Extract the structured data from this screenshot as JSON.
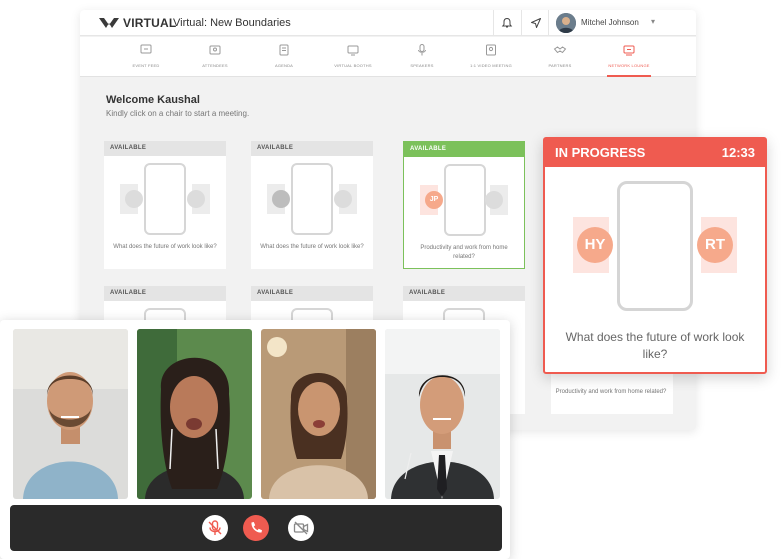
{
  "app": {
    "brand": "VIRTUAL",
    "event_title": "Virtual: New Boundaries",
    "user_name": "Mitchel Johnson"
  },
  "nav": [
    {
      "label": "EVENT FEED",
      "icon": "event-feed-icon"
    },
    {
      "label": "ATTENDEES",
      "icon": "attendees-icon"
    },
    {
      "label": "AGENDA",
      "icon": "agenda-icon"
    },
    {
      "label": "VIRTUAL BOOTHS",
      "icon": "virtual-booths-icon"
    },
    {
      "label": "SPEAKERS",
      "icon": "speakers-icon"
    },
    {
      "label": "1:1 VIDEO MEETING",
      "icon": "video-meeting-icon"
    },
    {
      "label": "PARTNERS",
      "icon": "partners-icon"
    },
    {
      "label": "NETWORK LOUNGE",
      "icon": "network-lounge-icon",
      "active": true
    }
  ],
  "lounge": {
    "welcome": "Welcome Kaushal",
    "subtitle": "Kindly click on a chair to start a meeting."
  },
  "tables": [
    {
      "status": "AVAILABLE",
      "question": "What does the future of work look like?"
    },
    {
      "status": "AVAILABLE",
      "question": "What does the future of work look like?"
    },
    {
      "status": "AVAILABLE",
      "question": "Productivity and work from home related?",
      "occupant": "JP"
    },
    {
      "status": "AVAILABLE"
    },
    {
      "status": "AVAILABLE"
    },
    {
      "status": "AVAILABLE"
    }
  ],
  "partial_card_question": "Productivity and work from home related?",
  "in_progress": {
    "status": "IN PROGRESS",
    "timer": "12:33",
    "left_initials": "HY",
    "right_initials": "RT",
    "question": "What does the future of work look like?"
  },
  "colors": {
    "accent": "#ef5b50",
    "available_selected": "#7cc15b",
    "seat_occupied": "#f6a98b"
  },
  "call_controls": [
    "mute-mic-icon",
    "end-call-icon",
    "video-off-icon"
  ]
}
